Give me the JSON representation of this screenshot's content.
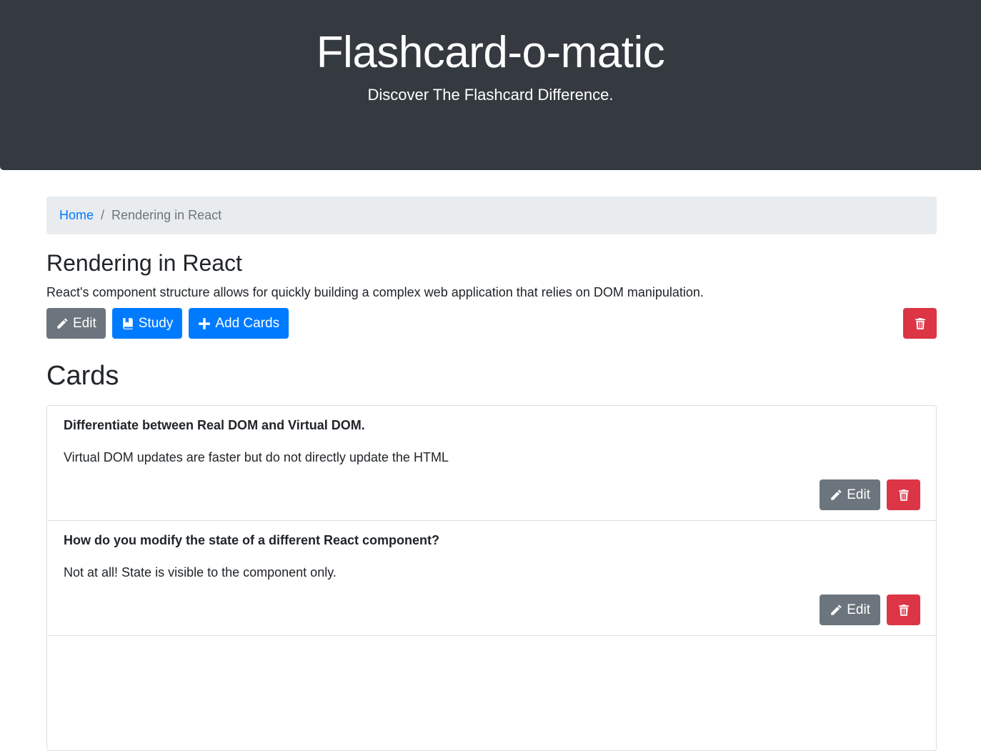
{
  "header": {
    "title": "Flashcard-o-matic",
    "tagline": "Discover The Flashcard Difference."
  },
  "breadcrumb": {
    "home_label": "Home",
    "separator": "/",
    "current": "Rendering in React"
  },
  "deck": {
    "name": "Rendering in React",
    "description": "React's component structure allows for quickly building a complex web application that relies on DOM manipulation.",
    "edit_label": "Edit",
    "study_label": "Study",
    "add_cards_label": "Add Cards"
  },
  "cards_heading": "Cards",
  "cards": [
    {
      "front": "Differentiate between Real DOM and Virtual DOM.",
      "back": "Virtual DOM updates are faster but do not directly update the HTML",
      "edit_label": "Edit"
    },
    {
      "front": "How do you modify the state of a different React component?",
      "back": "Not at all! State is visible to the component only.",
      "edit_label": "Edit"
    }
  ],
  "icons": {
    "edit": "pencil-icon",
    "study": "book-icon",
    "add": "plus-icon",
    "delete": "trash-icon"
  },
  "colors": {
    "header_bg": "#343a40",
    "primary": "#007bff",
    "secondary": "#6c757d",
    "danger": "#dc3545",
    "breadcrumb_bg": "#e9ecef"
  }
}
